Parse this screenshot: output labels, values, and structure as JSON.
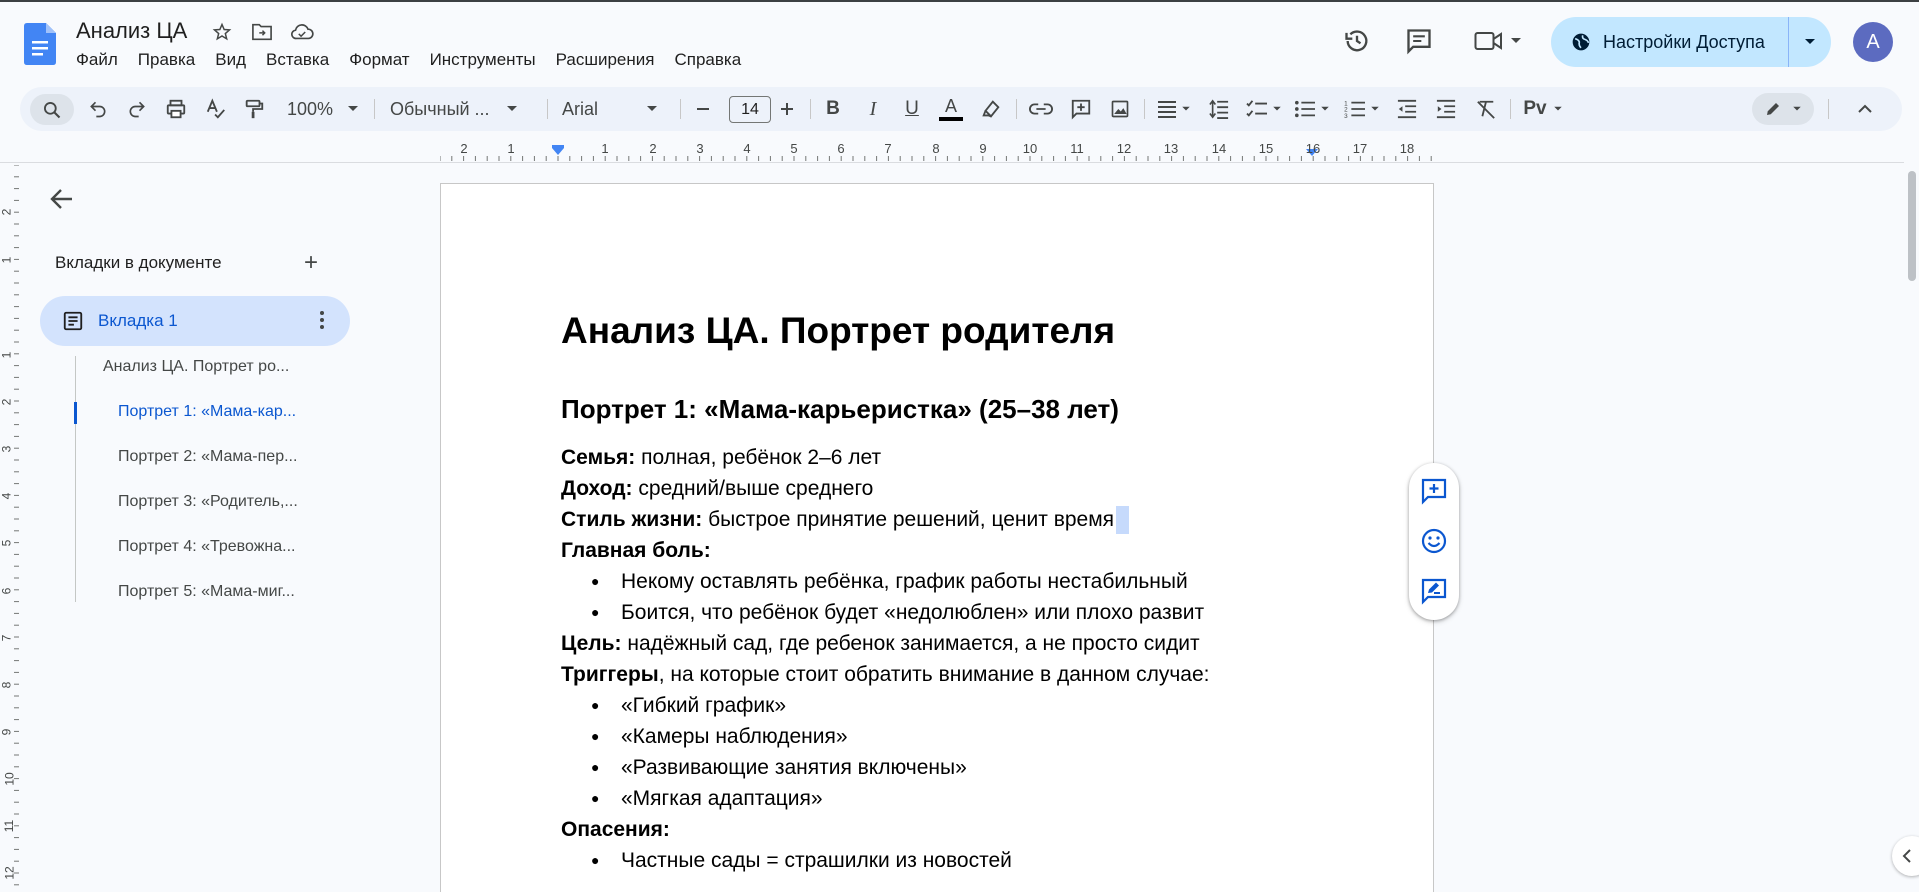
{
  "app": {
    "doc_title": "Анализ ЦА",
    "menu": [
      "Файл",
      "Правка",
      "Вид",
      "Вставка",
      "Формат",
      "Инструменты",
      "Расширения",
      "Справка"
    ],
    "share_label": "Настройки Доступа",
    "avatar_letter": "A"
  },
  "toolbar": {
    "zoom": "100%",
    "style": "Обычный ...",
    "font": "Arial",
    "font_size": "14",
    "icons": [
      "search-icon",
      "undo-icon",
      "redo-icon",
      "print-icon",
      "spellcheck-icon",
      "paint-format-icon",
      "bold-icon",
      "italic-icon",
      "underline-icon",
      "text-color-icon",
      "highlight-icon",
      "link-icon",
      "add-comment-icon",
      "image-icon",
      "align-icon",
      "line-spacing-icon",
      "checklist-icon",
      "bulleted-list-icon",
      "numbered-list-icon",
      "decrease-indent-icon",
      "increase-indent-icon",
      "clear-formatting-icon",
      "variables-icon",
      "edit-mode-icon",
      "collapse-icon"
    ]
  },
  "ruler": {
    "h_labels": [
      "2",
      "1",
      "1",
      "2",
      "3",
      "4",
      "5",
      "6",
      "7",
      "8",
      "9",
      "10",
      "11",
      "12",
      "13",
      "14",
      "15",
      "16",
      "17",
      "18"
    ],
    "v_labels": [
      "2",
      "1",
      "1",
      "2",
      "3",
      "4",
      "5",
      "6",
      "7",
      "8",
      "9",
      "10",
      "11",
      "12"
    ]
  },
  "sidebar": {
    "title": "Вкладки в документе",
    "active_tab": "Вкладка 1",
    "outline": [
      {
        "label": "Анализ ЦА. Портрет ро...",
        "active": false
      },
      {
        "label": "Портрет 1: «Мама-кар...",
        "active": true
      },
      {
        "label": "Портрет 2: «Мама-пер...",
        "active": false
      },
      {
        "label": "Портрет 3: «Родитель,...",
        "active": false
      },
      {
        "label": "Портрет 4: «Тревожна...",
        "active": false
      },
      {
        "label": "Портрет 5: «Мама-миг...",
        "active": false
      }
    ]
  },
  "doc": {
    "h1": "Анализ ЦА. Портрет родителя",
    "h2": "Портрет 1: «Мама-карьеристка» (25–38 лет)",
    "family_label": "Семья:",
    "family_value": " полная, ребёнок 2–6 лет",
    "income_label": "Доход:",
    "income_value": " средний/выше среднего",
    "lifestyle_label": "Стиль жизни:",
    "lifestyle_value": " быстрое принятие решений, ценит время",
    "pain_label": "Главная боль:",
    "pain_items": [
      "Некому оставлять ребёнка, график работы нестабильный",
      "Боится, что ребёнок будет «недолюблен» или плохо развит"
    ],
    "goal_label": "Цель:",
    "goal_value": " надёжный сад, где ребенок занимается, а не просто сидит",
    "triggers_label": "Триггеры",
    "triggers_value": ", на которые стоит обратить внимание в данном случае:",
    "trigger_items": [
      "«Гибкий график»",
      "«Камеры наблюдения»",
      "«Развивающие занятия включены»",
      "«Мягкая адаптация»"
    ],
    "fears_label": "Опасения:",
    "fear_items": [
      "Частные сады = страшилки из новостей"
    ]
  }
}
